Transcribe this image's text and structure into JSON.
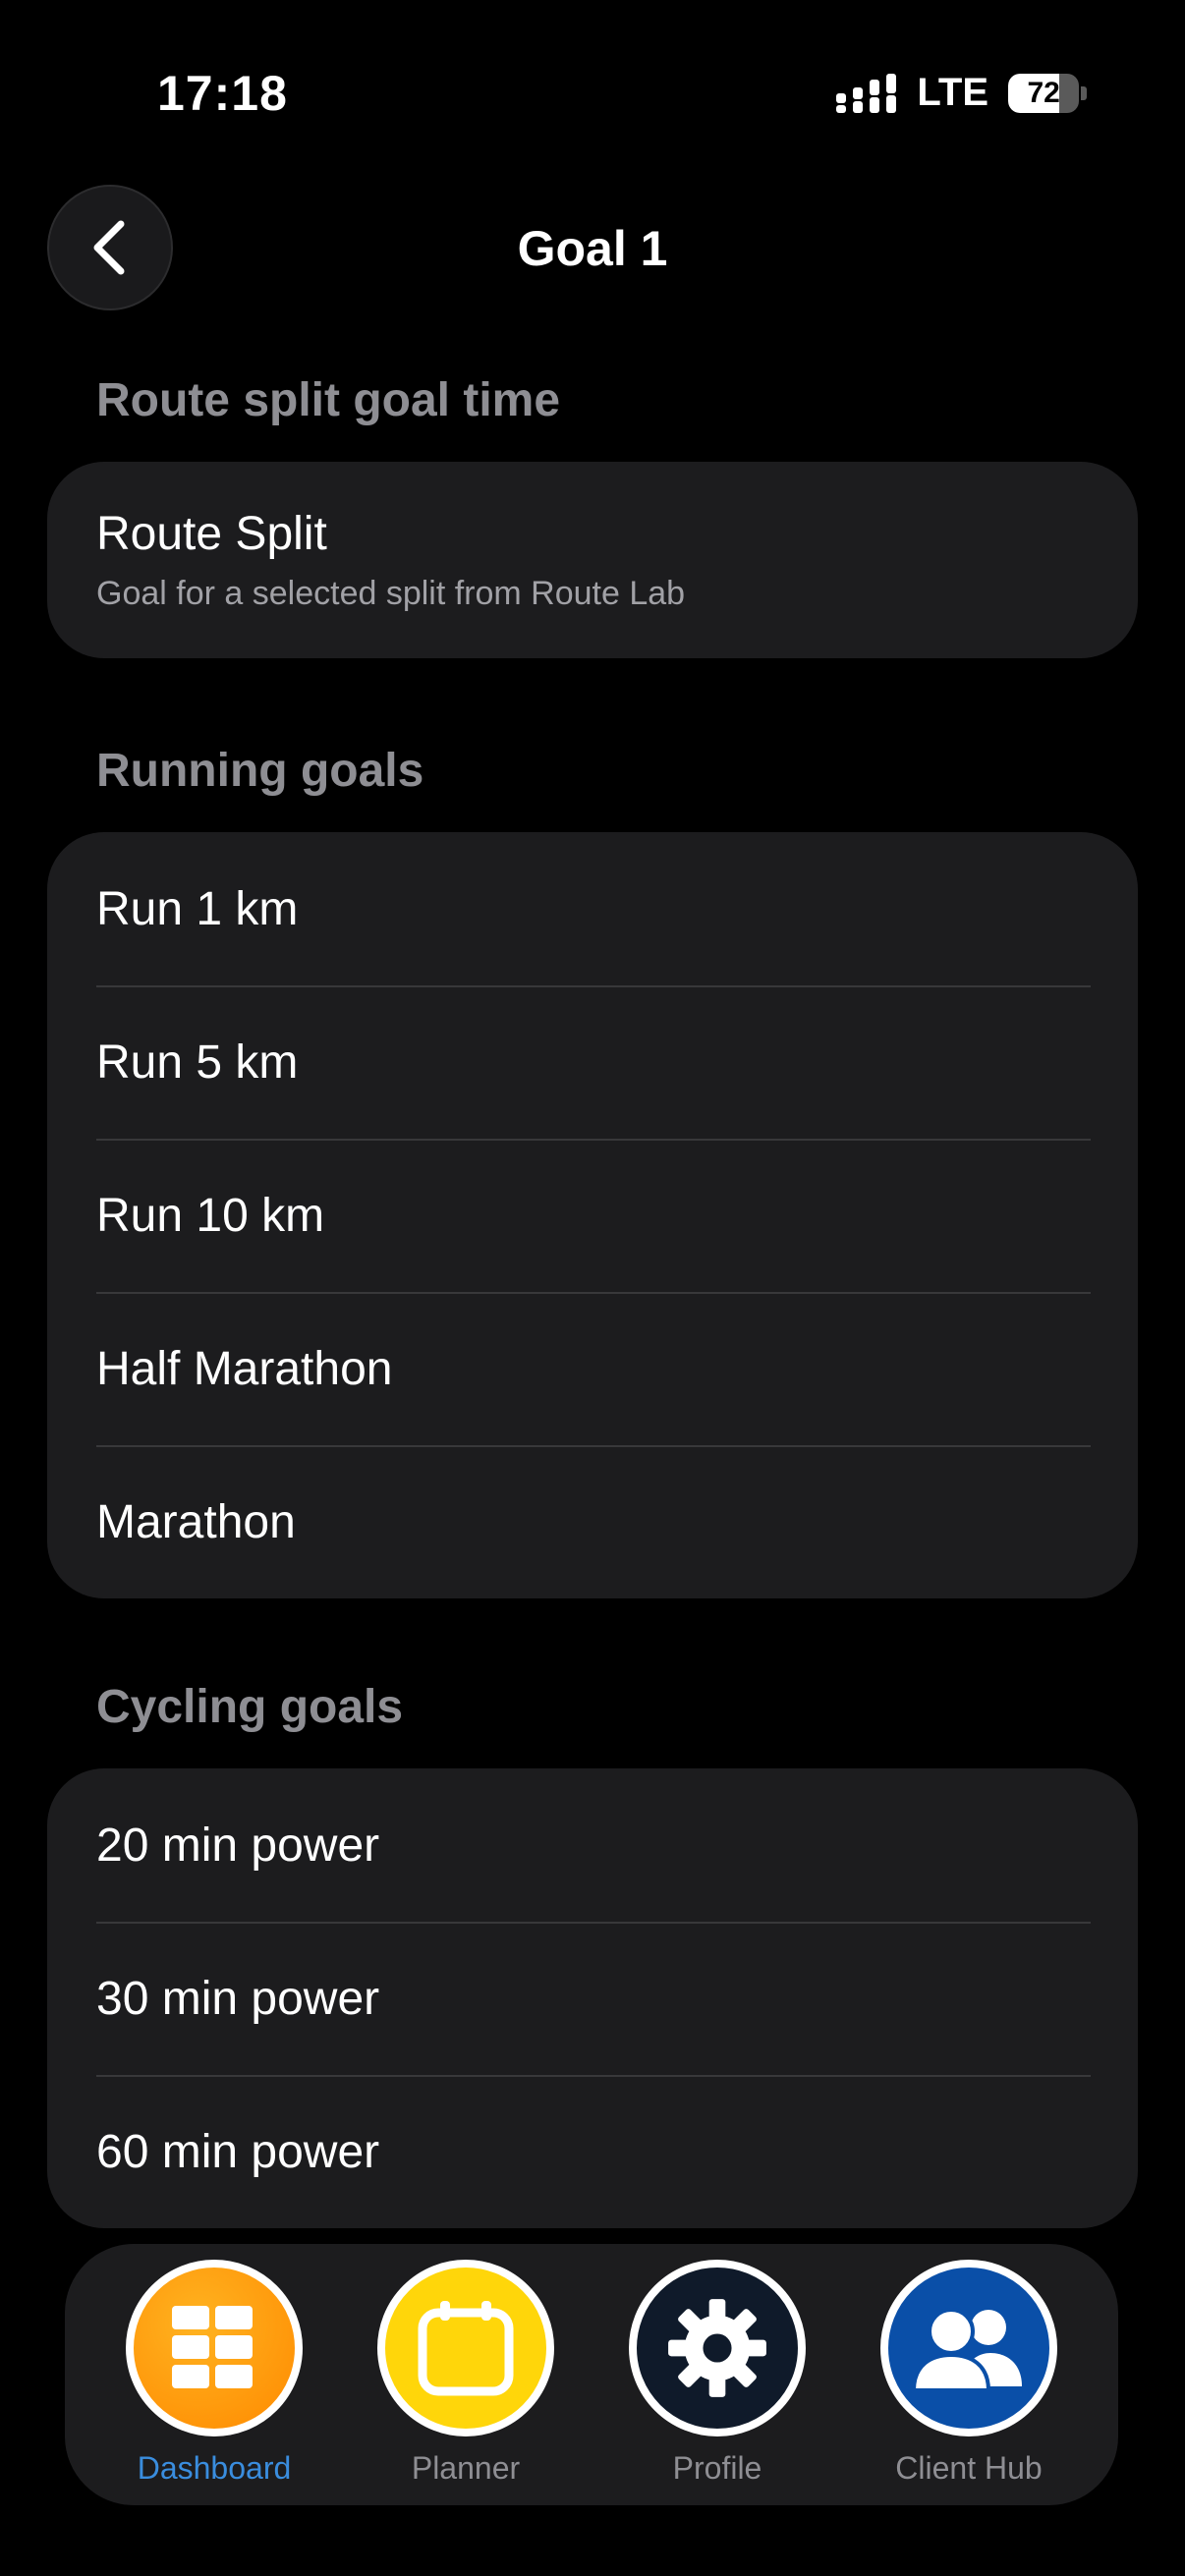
{
  "status_bar": {
    "time": "17:18",
    "network": "LTE",
    "battery_level": "72",
    "battery_fraction": 0.72
  },
  "header": {
    "title": "Goal 1",
    "back_icon": "chevron-left-icon"
  },
  "route_split_section": {
    "title": "Route split goal time",
    "item_title": "Route Split",
    "item_subtitle": "Goal for a selected split from Route Lab"
  },
  "running_section": {
    "title": "Running goals",
    "items": [
      "Run 1 km",
      "Run 5 km",
      "Run 10 km",
      "Half Marathon",
      "Marathon"
    ]
  },
  "cycling_section": {
    "title": "Cycling goals",
    "items": [
      "20 min power",
      "30 min power",
      "60 min power"
    ]
  },
  "tab_bar": {
    "tabs": [
      {
        "label": "Dashboard",
        "icon": "grid-icon",
        "color": "#ff9f0a",
        "active": true
      },
      {
        "label": "Planner",
        "icon": "calendar-icon",
        "color": "#ffd60a",
        "active": false
      },
      {
        "label": "Profile",
        "icon": "gear-icon",
        "color": "#0f1a2a",
        "active": false
      },
      {
        "label": "Client Hub",
        "icon": "people-icon",
        "color": "#0a4fa8",
        "active": false
      }
    ]
  }
}
